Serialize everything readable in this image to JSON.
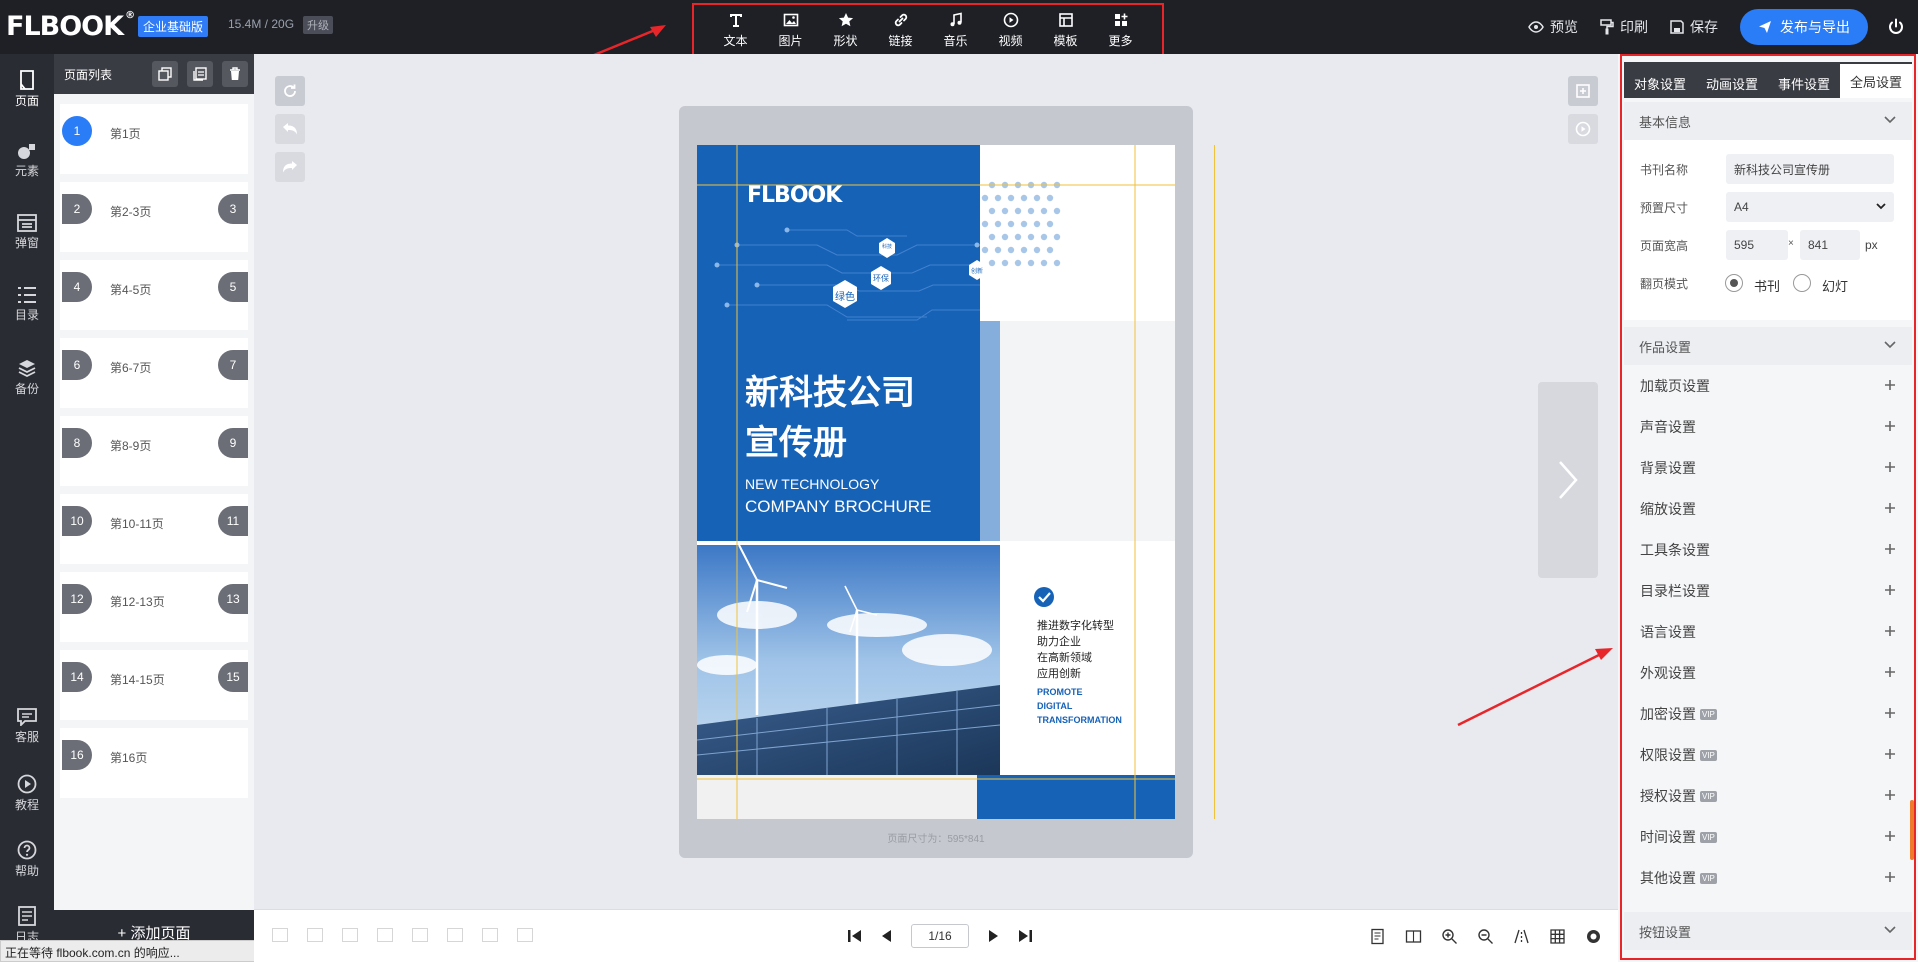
{
  "topbar": {
    "logo": "FLBOOK",
    "plan_badge": "企业基础版",
    "storage": "15.4M / 20G",
    "upgrade": "升级",
    "tools": [
      {
        "label": "文本",
        "icon": "text-icon"
      },
      {
        "label": "图片",
        "icon": "image-icon"
      },
      {
        "label": "形状",
        "icon": "star-icon"
      },
      {
        "label": "链接",
        "icon": "link-icon"
      },
      {
        "label": "音乐",
        "icon": "music-icon"
      },
      {
        "label": "视频",
        "icon": "video-icon"
      },
      {
        "label": "模板",
        "icon": "template-icon"
      },
      {
        "label": "更多",
        "icon": "more-icon"
      }
    ],
    "preview": "预览",
    "print": "印刷",
    "save": "保存",
    "publish": "发布与导出"
  },
  "sidenav": {
    "items": [
      {
        "label": "页面",
        "icon": "page-icon"
      },
      {
        "label": "元素",
        "icon": "element-icon"
      },
      {
        "label": "弹窗",
        "icon": "popup-icon"
      },
      {
        "label": "目录",
        "icon": "toc-icon"
      },
      {
        "label": "备份",
        "icon": "backup-icon"
      }
    ],
    "bottom_items": [
      {
        "label": "客服",
        "icon": "chat-icon"
      },
      {
        "label": "教程",
        "icon": "play-icon"
      },
      {
        "label": "帮助",
        "icon": "help-icon"
      },
      {
        "label": "日志",
        "icon": "log-icon"
      }
    ]
  },
  "pagelist": {
    "title": "页面列表",
    "pages": [
      {
        "label": "第1页",
        "left": "1",
        "right": ""
      },
      {
        "label": "第2-3页",
        "left": "2",
        "right": "3"
      },
      {
        "label": "第4-5页",
        "left": "4",
        "right": "5"
      },
      {
        "label": "第6-7页",
        "left": "6",
        "right": "7"
      },
      {
        "label": "第8-9页",
        "left": "8",
        "right": "9"
      },
      {
        "label": "第10-11页",
        "left": "10",
        "right": "11"
      },
      {
        "label": "第12-13页",
        "left": "12",
        "right": "13"
      },
      {
        "label": "第14-15页",
        "left": "14",
        "right": "15"
      },
      {
        "label": "第16页",
        "left": "16",
        "right": ""
      }
    ],
    "add_page": "+ 添加页面"
  },
  "statusbar": "正在等待 flbook.com.cn 的响应...",
  "page": {
    "logo": "FLBOOK",
    "tags": [
      "科技",
      "环保",
      "绿色",
      "创新"
    ],
    "title_line1": "新科技公司",
    "title_line2": "宣传册",
    "subtitle_line1": "NEW TECHNOLOGY",
    "subtitle_line2": "COMPANY BROCHURE",
    "bullets": [
      "推进数字化转型",
      "助力企业",
      "在高新领域",
      "应用创新"
    ],
    "promo": [
      "PROMOTE",
      "DIGITAL",
      "TRANSFORMATION"
    ],
    "dimension_label": "页面尺寸为：595*841"
  },
  "pager": {
    "value": "1/16"
  },
  "rpanel": {
    "tabs": [
      "对象设置",
      "动画设置",
      "事件设置",
      "全局设置"
    ],
    "active_tab": "全局设置",
    "basic_info": {
      "title": "基本信息",
      "book_name_label": "书刊名称",
      "book_name_value": "新科技公司宣传册",
      "preset_label": "预置尺寸",
      "preset_value": "A4",
      "size_label": "页面宽高",
      "width": "595",
      "height": "841",
      "times": "×",
      "unit": "px",
      "mode_label": "翻页模式",
      "mode_book": "书刊",
      "mode_slide": "幻灯"
    },
    "work_settings_title": "作品设置",
    "settings": [
      {
        "label": "加载页设置",
        "vip": false
      },
      {
        "label": "声音设置",
        "vip": false
      },
      {
        "label": "背景设置",
        "vip": false
      },
      {
        "label": "缩放设置",
        "vip": false
      },
      {
        "label": "工具条设置",
        "vip": false
      },
      {
        "label": "目录栏设置",
        "vip": false
      },
      {
        "label": "语言设置",
        "vip": false
      },
      {
        "label": "外观设置",
        "vip": false
      },
      {
        "label": "加密设置",
        "vip": true
      },
      {
        "label": "权限设置",
        "vip": true
      },
      {
        "label": "授权设置",
        "vip": true
      },
      {
        "label": "时间设置",
        "vip": true
      },
      {
        "label": "其他设置",
        "vip": true
      }
    ],
    "vip_label": "VIP",
    "button_settings_title": "按钮设置"
  },
  "colors": {
    "accent": "#2b7cf7",
    "brand_blue": "#1662b7",
    "annotation_red": "#e8262a",
    "topbar": "#1f2026"
  }
}
